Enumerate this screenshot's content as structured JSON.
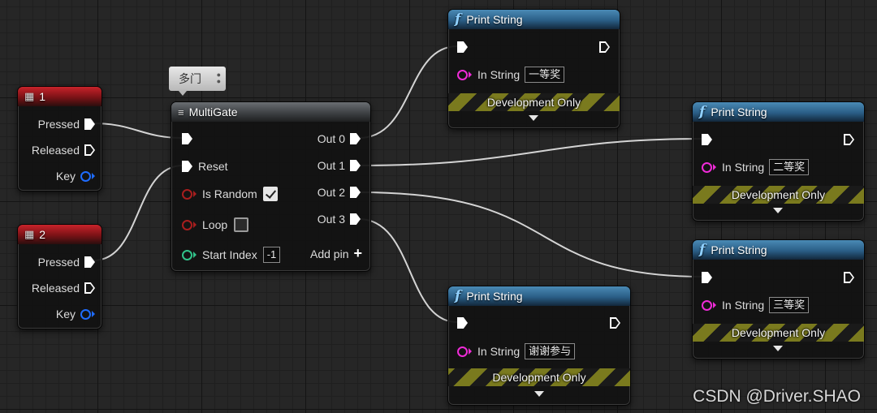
{
  "input_key_1": {
    "title": "1",
    "pins": {
      "pressed": "Pressed",
      "released": "Released",
      "key": "Key"
    }
  },
  "input_key_2": {
    "title": "2",
    "pins": {
      "pressed": "Pressed",
      "released": "Released",
      "key": "Key"
    }
  },
  "comment_bubble": {
    "text": "多门"
  },
  "multigate": {
    "title": "MultiGate",
    "reset": "Reset",
    "is_random": "Is Random",
    "is_random_checked": true,
    "loop": "Loop",
    "loop_checked": false,
    "start_index": "Start Index",
    "start_index_value": "-1",
    "outputs": [
      "Out 0",
      "Out 1",
      "Out 2",
      "Out 3"
    ],
    "add_pin": "Add pin"
  },
  "print_nodes": [
    {
      "title": "Print String",
      "in_label": "In String",
      "value": "一等奖",
      "dev": "Development Only"
    },
    {
      "title": "Print String",
      "in_label": "In String",
      "value": "二等奖",
      "dev": "Development Only"
    },
    {
      "title": "Print String",
      "in_label": "In String",
      "value": "三等奖",
      "dev": "Development Only"
    },
    {
      "title": "Print String",
      "in_label": "In String",
      "value": "谢谢参与",
      "dev": "Development Only"
    }
  ],
  "watermark": "CSDN @Driver.SHAO",
  "colors": {
    "exec_wire": "#d9d9d9",
    "key_pin": "#1e6cff",
    "bool_pin": "#a81e1e",
    "int_pin": "#31c38a",
    "string_pin": "#f02bd8",
    "input_header": "#c8232a",
    "function_header": "#2a5e86"
  }
}
